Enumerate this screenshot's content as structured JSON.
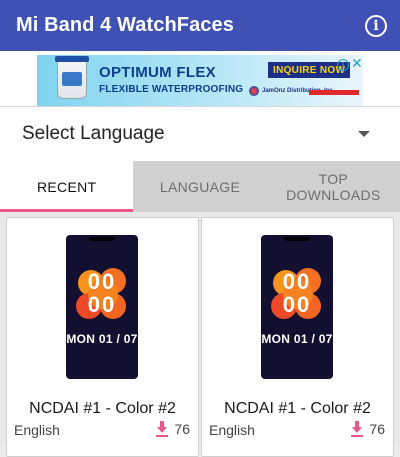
{
  "app_bar": {
    "title": "Mi Band 4 WatchFaces",
    "info_icon": "info-icon"
  },
  "ad": {
    "headline": "OPTIMUM FLEX",
    "subline": "FLEXIBLE WATERPROOFING",
    "cta": "INQUIRE NOW",
    "adchoices_icon": "info",
    "close_icon": "✕",
    "company": "JamOnz Distribution, Inc."
  },
  "language_select": {
    "label": "Select Language"
  },
  "tabs": [
    {
      "label": "RECENT",
      "active": true
    },
    {
      "label": "LANGUAGE",
      "active": false
    },
    {
      "label": "TOP\nDOWNLOADS",
      "active": false
    }
  ],
  "tabs_display": {
    "recent": "RECENT",
    "language": "LANGUAGE",
    "top_line1": "TOP",
    "top_line2": "DOWNLOADS"
  },
  "watchfaces": [
    {
      "name": "NCDAI #1 - Color #2",
      "language": "English",
      "downloads": "76",
      "preview": {
        "time_top": "00",
        "time_bottom": "00",
        "date": "MON 01 / 07"
      }
    },
    {
      "name": "NCDAI #1 - Color #2",
      "language": "English",
      "downloads": "76",
      "preview": {
        "time_top": "00",
        "time_bottom": "00",
        "date": "MON 01 / 07"
      }
    }
  ],
  "colors": {
    "app_bar": "#3f51b5",
    "tab_indicator": "#e85a8c",
    "download_icon": "#e85a8c"
  }
}
